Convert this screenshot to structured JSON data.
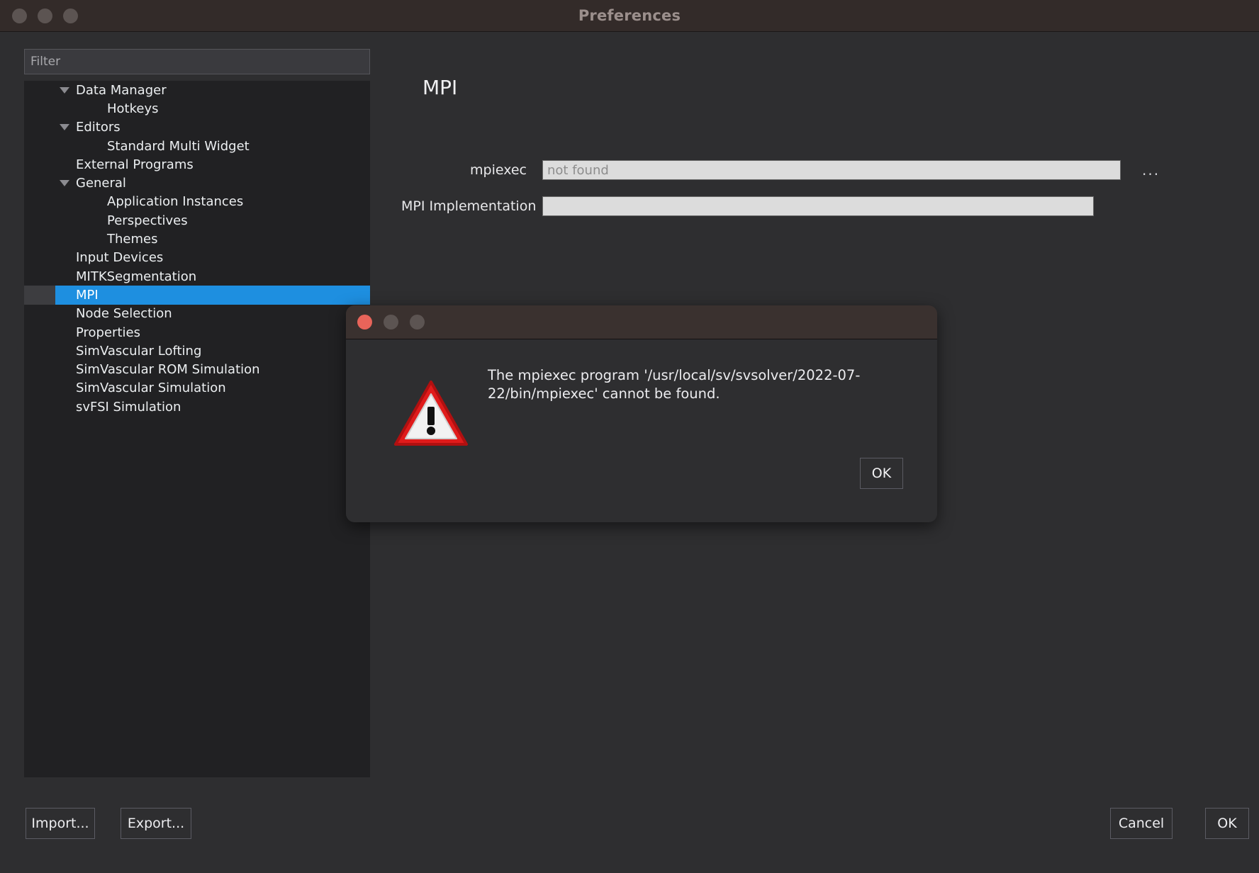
{
  "window": {
    "title": "Preferences",
    "traffic_lights": [
      "close",
      "minimize",
      "maximize"
    ]
  },
  "sidebar": {
    "filter": {
      "placeholder": "Filter",
      "value": ""
    },
    "items": [
      {
        "label": "Data Manager",
        "depth": 0,
        "twisty": "expanded",
        "selected": false
      },
      {
        "label": "Hotkeys",
        "depth": 1,
        "twisty": "none",
        "selected": false
      },
      {
        "label": "Editors",
        "depth": 0,
        "twisty": "expanded",
        "selected": false
      },
      {
        "label": "Standard Multi Widget",
        "depth": 1,
        "twisty": "none",
        "selected": false
      },
      {
        "label": "External Programs",
        "depth": 0,
        "twisty": "none",
        "selected": false
      },
      {
        "label": "General",
        "depth": 0,
        "twisty": "expanded",
        "selected": false
      },
      {
        "label": "Application Instances",
        "depth": 1,
        "twisty": "none",
        "selected": false
      },
      {
        "label": "Perspectives",
        "depth": 1,
        "twisty": "none",
        "selected": false
      },
      {
        "label": "Themes",
        "depth": 1,
        "twisty": "none",
        "selected": false
      },
      {
        "label": "Input Devices",
        "depth": 0,
        "twisty": "none",
        "selected": false
      },
      {
        "label": "MITKSegmentation",
        "depth": 0,
        "twisty": "none",
        "selected": false
      },
      {
        "label": "MPI",
        "depth": 0,
        "twisty": "none",
        "selected": true
      },
      {
        "label": "Node Selection",
        "depth": 0,
        "twisty": "none",
        "selected": false
      },
      {
        "label": "Properties",
        "depth": 0,
        "twisty": "none",
        "selected": false
      },
      {
        "label": "SimVascular Lofting",
        "depth": 0,
        "twisty": "none",
        "selected": false
      },
      {
        "label": "SimVascular ROM Simulation",
        "depth": 0,
        "twisty": "none",
        "selected": false
      },
      {
        "label": "SimVascular Simulation",
        "depth": 0,
        "twisty": "none",
        "selected": false
      },
      {
        "label": "svFSI Simulation",
        "depth": 0,
        "twisty": "none",
        "selected": false
      }
    ]
  },
  "main": {
    "title": "MPI",
    "fields": {
      "mpiexec": {
        "label": "mpiexec",
        "value": "",
        "placeholder": "not found",
        "browse_label": "..."
      },
      "mpi_implementation": {
        "label": "MPI Implementation",
        "value": "",
        "placeholder": ""
      }
    }
  },
  "footer": {
    "import_label": "Import...",
    "export_label": "Export...",
    "cancel_label": "Cancel",
    "ok_label": "OK"
  },
  "dialog": {
    "title": "",
    "icon": "warning-triangle",
    "message": "The mpiexec program '/usr/local/sv/svsolver/2022-07-22/bin/mpiexec' cannot be found.",
    "ok_label": "OK",
    "traffic_lights": [
      "close",
      "minimize",
      "maximize"
    ]
  },
  "colors": {
    "titlebar": "#332b29",
    "window_bg": "#2e2e30",
    "tree_bg": "#212123",
    "selection": "#1e8fe0",
    "field_bg": "#dcdcdc",
    "close_button": "#e8645a",
    "warning_red": "#e01b1b"
  }
}
